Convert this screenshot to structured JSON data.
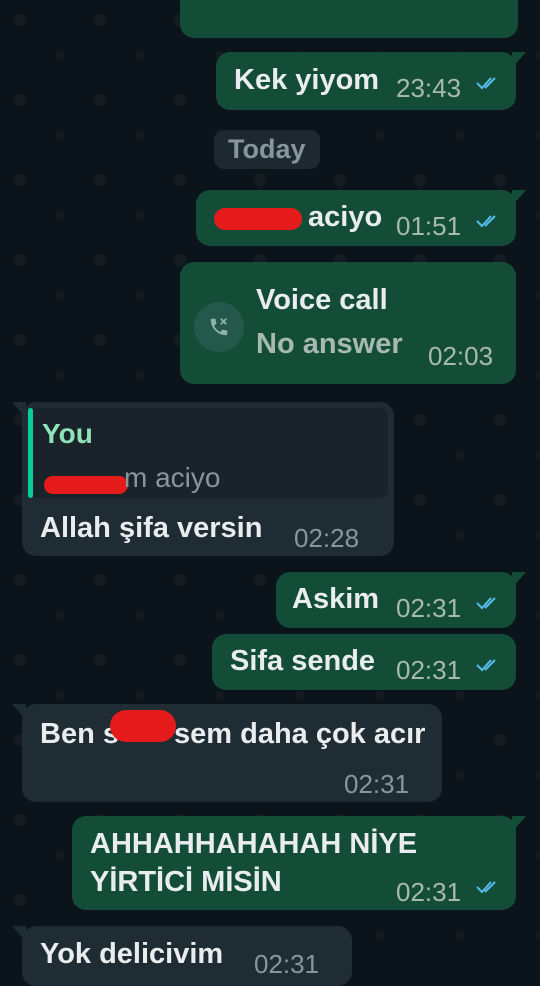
{
  "colors": {
    "outgoing": "#144d37",
    "incoming": "#202c33",
    "background": "#0b141a",
    "read_ticks": "#53bdeb",
    "quote_bar": "#06cf9c"
  },
  "date_divider": "Today",
  "messages": [
    {
      "text": "Kek yiyom",
      "time": "23:43",
      "direction": "out",
      "ticks": "double-check-icon"
    },
    {
      "text": "aciyo",
      "time": "01:51",
      "direction": "out",
      "ticks": "double-check-icon"
    },
    {
      "call_title": "Voice call",
      "call_status": "No answer",
      "time": "02:03",
      "direction": "out",
      "icon": "phone-missed-icon"
    },
    {
      "quote_author": "You",
      "quote_text": "m aciyo",
      "text": "Allah şifa versin",
      "time": "02:28",
      "direction": "in"
    },
    {
      "text": "Askim",
      "time": "02:31",
      "direction": "out",
      "ticks": "double-check-icon"
    },
    {
      "text": "Sifa sende",
      "time": "02:31",
      "direction": "out",
      "ticks": "double-check-icon"
    },
    {
      "text_before": "Ben s",
      "text_after": "sem daha çok acır",
      "time": "02:31",
      "direction": "in"
    },
    {
      "line1": "AHHAHHAHAHAH NİYE",
      "line2": "YİRTİCİ MİSİN",
      "time": "02:31",
      "direction": "out",
      "ticks": "double-check-icon"
    },
    {
      "text": "Yok delicivim",
      "time": "02:31",
      "direction": "in"
    }
  ]
}
